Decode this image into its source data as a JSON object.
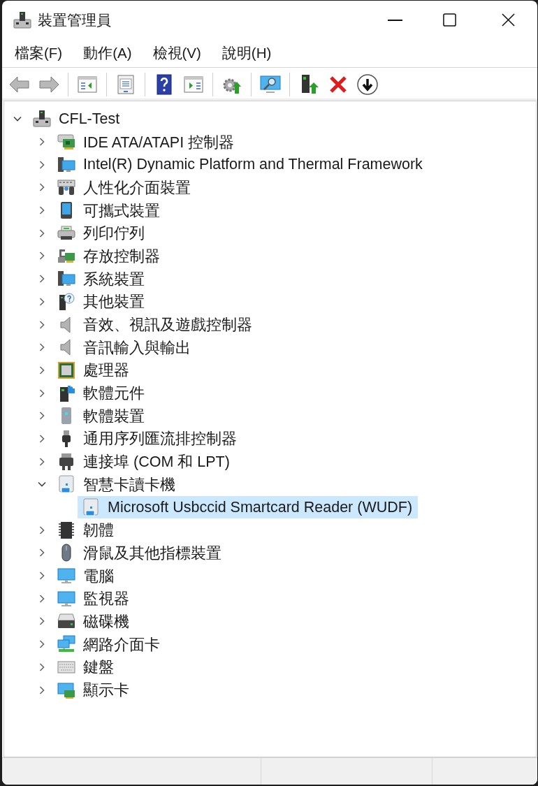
{
  "window": {
    "title": "裝置管理員"
  },
  "menu": [
    "檔案(F)",
    "動作(A)",
    "檢視(V)",
    "說明(H)"
  ],
  "tree": {
    "label": "CFL-Test",
    "kind": "computer",
    "expanded": true,
    "selected": false,
    "children": [
      {
        "label": "IDE ATA/ATAPI 控制器",
        "kind": "ide",
        "expanded": false,
        "selected": false
      },
      {
        "label": "Intel(R) Dynamic Platform and Thermal Framework",
        "kind": "system",
        "expanded": false,
        "selected": false
      },
      {
        "label": "人性化介面裝置",
        "kind": "hid",
        "expanded": false,
        "selected": false
      },
      {
        "label": "可攜式裝置",
        "kind": "portable",
        "expanded": false,
        "selected": false
      },
      {
        "label": "列印佇列",
        "kind": "printer",
        "expanded": false,
        "selected": false
      },
      {
        "label": "存放控制器",
        "kind": "storage",
        "expanded": false,
        "selected": false
      },
      {
        "label": "系統裝置",
        "kind": "system",
        "expanded": false,
        "selected": false
      },
      {
        "label": "其他裝置",
        "kind": "other",
        "expanded": false,
        "selected": false
      },
      {
        "label": "音效、視訊及遊戲控制器",
        "kind": "sound",
        "expanded": false,
        "selected": false
      },
      {
        "label": "音訊輸入與輸出",
        "kind": "sound",
        "expanded": false,
        "selected": false
      },
      {
        "label": "處理器",
        "kind": "processor",
        "expanded": false,
        "selected": false
      },
      {
        "label": "軟體元件",
        "kind": "component",
        "expanded": false,
        "selected": false
      },
      {
        "label": "軟體裝置",
        "kind": "softwaredevice",
        "expanded": false,
        "selected": false
      },
      {
        "label": "通用序列匯流排控制器",
        "kind": "usb",
        "expanded": false,
        "selected": false
      },
      {
        "label": "連接埠 (COM 和 LPT)",
        "kind": "ports",
        "expanded": false,
        "selected": false
      },
      {
        "label": "智慧卡讀卡機",
        "kind": "smartcard",
        "expanded": true,
        "selected": false,
        "children": [
          {
            "label": "Microsoft Usbccid Smartcard Reader (WUDF)",
            "kind": "smartcard",
            "selected": true
          }
        ]
      },
      {
        "label": "韌體",
        "kind": "firmware",
        "expanded": false,
        "selected": false
      },
      {
        "label": "滑鼠及其他指標裝置",
        "kind": "mouse",
        "expanded": false,
        "selected": false
      },
      {
        "label": "電腦",
        "kind": "monitor",
        "expanded": false,
        "selected": false
      },
      {
        "label": "監視器",
        "kind": "monitor",
        "expanded": false,
        "selected": false
      },
      {
        "label": "磁碟機",
        "kind": "disk",
        "expanded": false,
        "selected": false
      },
      {
        "label": "網路介面卡",
        "kind": "network",
        "expanded": false,
        "selected": false
      },
      {
        "label": "鍵盤",
        "kind": "keyboard",
        "expanded": false,
        "selected": false
      },
      {
        "label": "顯示卡",
        "kind": "display",
        "expanded": false,
        "selected": false
      }
    ]
  }
}
